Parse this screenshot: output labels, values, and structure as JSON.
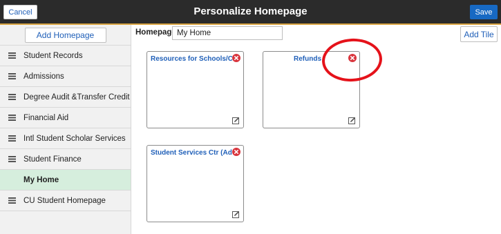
{
  "header": {
    "cancel_label": "Cancel",
    "title": "Personalize Homepage",
    "save_label": "Save"
  },
  "sidebar": {
    "add_label": "Add Homepage",
    "items": [
      {
        "label": "Student Records",
        "selected": false
      },
      {
        "label": "Admissions",
        "selected": false
      },
      {
        "label": "Degree Audit &Transfer Credit",
        "selected": false
      },
      {
        "label": "Financial Aid",
        "selected": false
      },
      {
        "label": "Intl Student Scholar Services",
        "selected": false
      },
      {
        "label": "Student Finance",
        "selected": false
      },
      {
        "label": "My Home",
        "selected": true
      },
      {
        "label": "CU Student Homepage",
        "selected": false
      }
    ]
  },
  "main": {
    "homepage_label": "Homepage",
    "homepage_value": "My Home",
    "add_tile_label": "Add Tile",
    "tiles": [
      {
        "title": "Resources for Schools/Coll..."
      },
      {
        "title": "Refunds"
      },
      {
        "title": "Student Services Ctr (Admi..."
      }
    ]
  },
  "colors": {
    "header_bg": "#2b2b2b",
    "accent": "#d9a441",
    "link_blue": "#1f5fb8",
    "save_blue": "#1769c3",
    "selected_bg": "#d6eedd",
    "delete_red": "#d9363e",
    "annotation_red": "#e5121a"
  }
}
